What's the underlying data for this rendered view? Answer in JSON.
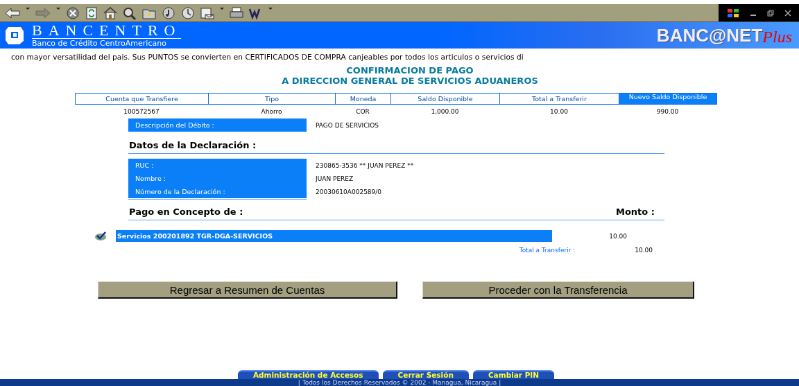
{
  "banner": {
    "bank_name": "BANCENTRO",
    "bank_subtitle": "Banco de Crédito CentroAmericano",
    "product_logo": "BANC@NET",
    "product_logo_suffix": "Plus"
  },
  "marquee": "con mayor versatilidad del pais. Sus PUNTOS se convierten en CERTIFICADOS DE COMPRA canjeables por todos los articulos o servicios di",
  "title_lines": [
    "CONFIRMACION DE PAGO",
    "A DIRECCION GENERAL DE SERVICIOS ADUANEROS"
  ],
  "transfer_table": {
    "columns": [
      {
        "label": "Cuenta que Transfiere",
        "highlighted": false
      },
      {
        "label": "Tipo",
        "highlighted": false
      },
      {
        "label": "Moneda",
        "highlighted": false
      },
      {
        "label": "Saldo Disponible",
        "highlighted": false
      },
      {
        "label": "Total a Transferir",
        "highlighted": false
      },
      {
        "label": "Nuevo Saldo Disponible",
        "highlighted": true
      }
    ],
    "row": [
      "100572567",
      "Ahorro",
      "COR",
      "1,000.00",
      "10.00",
      "990.00"
    ]
  },
  "debit": {
    "label": "Descripción del  Débito :",
    "value": "PAGO DE SERVICIOS"
  },
  "declaration": {
    "heading": "Datos de la Declaración :",
    "fields": [
      {
        "label": "RUC :",
        "value": "230865-3536 ** JUAN PEREZ **"
      },
      {
        "label": "Nombre :",
        "value": "JUAN PEREZ"
      },
      {
        "label": "Número de la Declaración :",
        "value": "20030610A002589/0"
      }
    ]
  },
  "payment": {
    "heading": "Pago en Concepto de :",
    "amount_heading": "Monto :",
    "items": [
      {
        "checked": true,
        "description": "Servicios 200201892 TGR-DGA-SERVICIOS",
        "amount": "10.00"
      }
    ],
    "total_label": "Total a Transferir :",
    "total": "10.00"
  },
  "buttons": [
    "Regresar a Resumen de Cuentas",
    "Proceder con la Transferencia"
  ],
  "footer": {
    "tabs": [
      "Administración de Accesos",
      "Cerrar Sesión",
      "Cambiar PIN"
    ],
    "copyright": "| Todos los Derechos Reservados © 2002 -  Managua, Nicaragua |"
  }
}
